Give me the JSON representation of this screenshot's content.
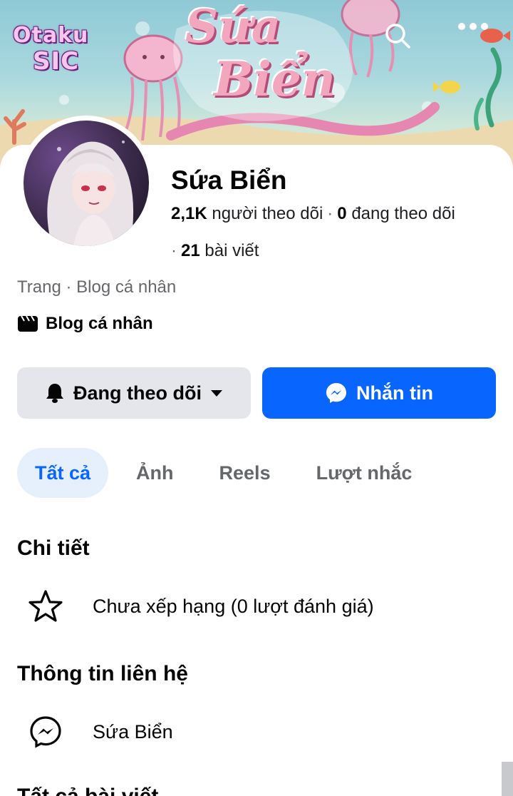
{
  "cover": {
    "logo_line1": "Otaku",
    "logo_line2": "SIC",
    "title_line1": "Sứa",
    "title_line2": "Biển"
  },
  "header_icons": {
    "search": "search-icon",
    "more": "more-icon"
  },
  "profile": {
    "name": "Sứa Biển",
    "followers_count": "2,1K",
    "followers_label": "người theo dõi",
    "following_count": "0",
    "following_label": "đang theo dõi",
    "posts_count": "21",
    "posts_label": "bài viết",
    "category": "Trang · Blog cá nhân",
    "blog_label": "Blog cá nhân"
  },
  "actions": {
    "following_label": "Đang theo dõi",
    "message_label": "Nhắn tin"
  },
  "tabs": [
    {
      "label": "Tất cả",
      "active": true
    },
    {
      "label": "Ảnh",
      "active": false
    },
    {
      "label": "Reels",
      "active": false
    },
    {
      "label": "Lượt nhắc",
      "active": false
    }
  ],
  "details": {
    "heading": "Chi tiết",
    "rating_text": "Chưa xếp hạng (0 lượt đánh giá)"
  },
  "contact": {
    "heading": "Thông tin liên hệ",
    "messenger_name": "Sứa Biển"
  },
  "next_section": {
    "heading": "Tất cả bài viết"
  },
  "colors": {
    "accent": "#0866ff",
    "tab_active_bg": "#e6f0fd",
    "button_gray": "#e4e6eb",
    "secondary_text": "#65676b"
  }
}
